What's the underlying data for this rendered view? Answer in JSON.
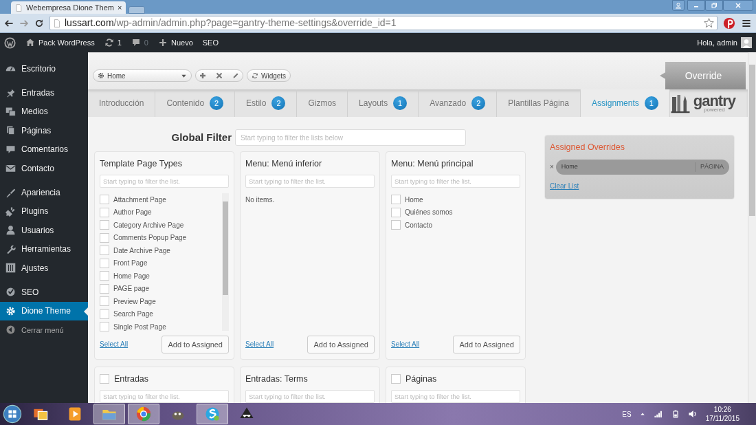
{
  "browser": {
    "tab_title": "Webempresa Dione Them",
    "tab_close": "×",
    "url_host": "lussart.com",
    "url_path": "/wp-admin/admin.php?page=gantry-theme-settings&override_id=1"
  },
  "admin_bar": {
    "items": [
      {
        "label": "Pack WordPress"
      },
      {
        "label": "1"
      },
      {
        "label": "0"
      },
      {
        "label": "Nuevo"
      },
      {
        "label": "SEO"
      }
    ],
    "greeting": "Hola, admin"
  },
  "sidebar": {
    "groups": [
      {
        "items": [
          {
            "label": "Escritorio",
            "selected": false
          }
        ]
      },
      {
        "items": [
          {
            "label": "Entradas",
            "selected": false
          },
          {
            "label": "Medios",
            "selected": false
          },
          {
            "label": "Páginas",
            "selected": false
          },
          {
            "label": "Comentarios",
            "selected": false
          },
          {
            "label": "Contacto",
            "selected": false
          }
        ]
      },
      {
        "items": [
          {
            "label": "Apariencia",
            "selected": false
          },
          {
            "label": "Plugins",
            "selected": false
          },
          {
            "label": "Usuarios",
            "selected": false
          },
          {
            "label": "Herramientas",
            "selected": false
          },
          {
            "label": "Ajustes",
            "selected": false
          }
        ]
      },
      {
        "items": [
          {
            "label": "SEO",
            "selected": false
          },
          {
            "label": "Dione Theme",
            "selected": true
          },
          {
            "label": "Cerrar menú",
            "selected": false,
            "kind": "collapse"
          }
        ]
      }
    ]
  },
  "toolbar": {
    "dropdown": "Home",
    "widgets_button": "Widgets",
    "override_button": "Override"
  },
  "tabs": [
    {
      "label": "Introducción",
      "selected": false
    },
    {
      "label": "Contenido",
      "count": "2",
      "selected": false
    },
    {
      "label": "Estilo",
      "count": "2",
      "selected": false
    },
    {
      "label": "Gizmos",
      "selected": false
    },
    {
      "label": "Layouts",
      "count": "1",
      "selected": false
    },
    {
      "label": "Avanzado",
      "count": "2",
      "selected": false
    },
    {
      "label": "Plantillas Página",
      "selected": false
    },
    {
      "label": "Assignments",
      "count": "1",
      "selected": true
    }
  ],
  "logo": {
    "name": "gantry",
    "tagline": "powered"
  },
  "global_filter": {
    "label": "Global Filter",
    "placeholder": "Start typing to filter the lists below"
  },
  "cards": [
    {
      "title": "Template Page Types",
      "placeholder": "Start typing to filter the list.",
      "items": [
        {
          "label": "Attachment Page",
          "checked": false
        },
        {
          "label": "Author Page",
          "checked": false
        },
        {
          "label": "Category Archive Page",
          "checked": false
        },
        {
          "label": "Comments Popup Page",
          "checked": false
        },
        {
          "label": "Date Archive Page",
          "checked": false
        },
        {
          "label": "Front Page",
          "checked": false
        },
        {
          "label": "Home Page",
          "checked": false
        },
        {
          "label": "PAGE page",
          "checked": false
        },
        {
          "label": "Preview Page",
          "checked": false
        },
        {
          "label": "Search Page",
          "checked": false
        },
        {
          "label": "Single Post Page",
          "checked": false
        }
      ],
      "select_all": "Select All",
      "add_button": "Add to Assigned"
    },
    {
      "title": "Menu: Menú inferior",
      "placeholder": "Start typing to filter the list.",
      "empty_text": "No items.",
      "select_all": "Select All",
      "add_button": "Add to Assigned"
    },
    {
      "title": "Menu: Menú principal",
      "placeholder": "Start typing to filter the list.",
      "items": [
        {
          "label": "Home",
          "checked": false
        },
        {
          "label": "Quiénes somos",
          "checked": false
        },
        {
          "label": "Contacto",
          "checked": false
        }
      ],
      "select_all": "Select All",
      "add_button": "Add to Assigned"
    },
    {
      "title": "Entradas",
      "checked": false,
      "placeholder": "Start typing to filter the list."
    },
    {
      "title": "Entradas: Terms",
      "placeholder": "Start typing to filter the list."
    },
    {
      "title": "Páginas",
      "checked": false,
      "placeholder": "Start typing to filter the list."
    }
  ],
  "assigned": {
    "title": "Assigned Overrides",
    "items": [
      {
        "remove": "×",
        "label": "Home",
        "type": "PÁGINA"
      }
    ],
    "clear": "Clear List"
  },
  "taskbar": {
    "apps": [
      {
        "selected": false
      },
      {
        "selected": false
      },
      {
        "selected": true
      },
      {
        "selected": true
      },
      {
        "selected": false
      },
      {
        "selected": true
      },
      {
        "selected": false
      }
    ],
    "language": "ES",
    "time": "10:26",
    "date": "17/11/2015"
  }
}
